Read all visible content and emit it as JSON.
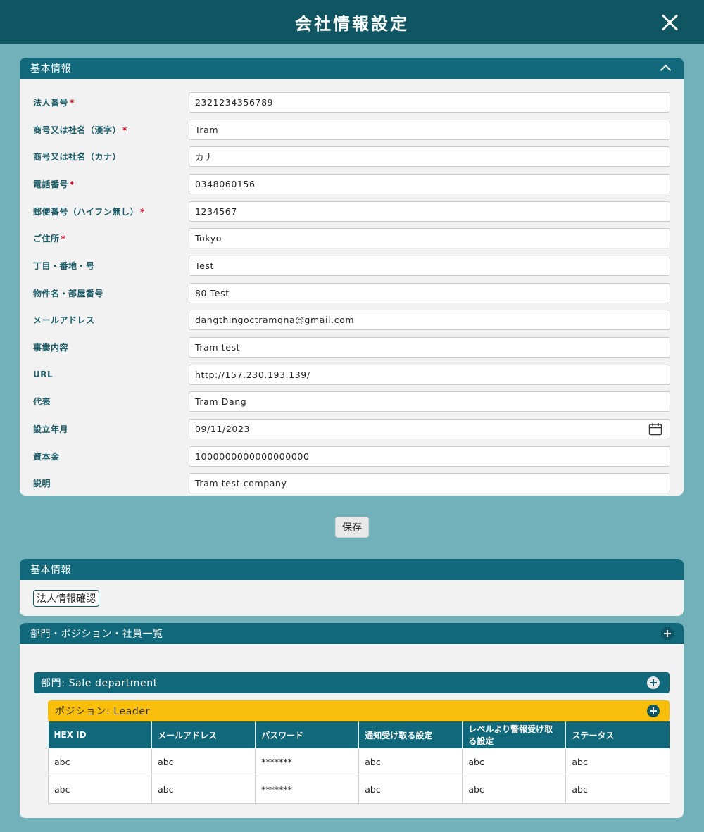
{
  "window": {
    "title": "会社情報設定"
  },
  "basic_info": {
    "header": "基本情報",
    "fields": [
      {
        "label": "法人番号",
        "required": true,
        "value": "2321234356789"
      },
      {
        "label": "商号又は社名（漢字）",
        "required": true,
        "value": "Tram"
      },
      {
        "label": "商号又は社名（カナ）",
        "required": false,
        "value": "カナ"
      },
      {
        "label": "電話番号",
        "required": true,
        "value": "0348060156"
      },
      {
        "label": "郵便番号（ハイフン無し）",
        "required": true,
        "value": "1234567"
      },
      {
        "label": "ご住所",
        "required": true,
        "value": "Tokyo"
      },
      {
        "label": "丁目・番地・号",
        "required": false,
        "value": "Test"
      },
      {
        "label": "物件名・部屋番号",
        "required": false,
        "value": "80 Test"
      },
      {
        "label": "メールアドレス",
        "required": false,
        "value": "dangthingoctramqna@gmail.com"
      },
      {
        "label": "事業内容",
        "required": false,
        "value": "Tram test"
      },
      {
        "label": "URL",
        "required": false,
        "value": "http://157.230.193.139/"
      },
      {
        "label": "代表",
        "required": false,
        "value": "Tram Dang"
      },
      {
        "label": "設立年月",
        "required": false,
        "value": "09/11/2023"
      },
      {
        "label": "資本金",
        "required": false,
        "value": "1000000000000000000"
      },
      {
        "label": "説明",
        "required": false,
        "value": "Tram test company"
      }
    ],
    "required_mark": "*"
  },
  "save_label": "保存",
  "corp_info": {
    "header": "基本情報",
    "confirm_label": "法人情報確認"
  },
  "org": {
    "header": "部門・ポジション・社員一覧",
    "department": "部門: Sale department",
    "position": "ポジション: Leader",
    "columns": [
      "HEX ID",
      "メールアドレス",
      "パスワード",
      "通知受け取る設定",
      "レベルより警報受け取る設定",
      "ステータス"
    ],
    "rows": [
      [
        "abc",
        "abc",
        "*******",
        "abc",
        "abc",
        "abc"
      ],
      [
        "abc",
        "abc",
        "*******",
        "abc",
        "abc",
        "abc"
      ]
    ]
  },
  "colors": {
    "primary": "#0f5662",
    "header": "#10687a",
    "background": "#72b0ba",
    "position_bar": "#f9be0a",
    "required": "#d0021b"
  }
}
